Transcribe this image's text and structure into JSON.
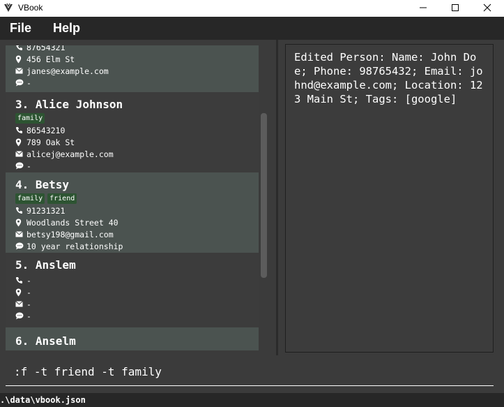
{
  "window": {
    "title": "VBook",
    "minimize_icon": "minimize-icon",
    "maximize_icon": "maximize-icon",
    "close_icon": "close-icon"
  },
  "menu": {
    "file_label": "File",
    "help_label": "Help"
  },
  "persons": [
    {
      "name": "",
      "tags": [],
      "phone": "87654321",
      "address": "456 Elm St",
      "email": "janes@example.com",
      "remark": "-"
    },
    {
      "name": "3. Alice Johnson",
      "tags": [
        "family"
      ],
      "phone": "86543210",
      "address": "789 Oak St",
      "email": "alicej@example.com",
      "remark": "-"
    },
    {
      "name": "4. Betsy",
      "tags": [
        "family",
        "friend"
      ],
      "phone": "91231321",
      "address": "Woodlands Street 40",
      "email": "betsy198@gmail.com",
      "remark": "10 year relationship"
    },
    {
      "name": "5. Anslem",
      "tags": [],
      "phone": "-",
      "address": "-",
      "email": "-",
      "remark": "-"
    },
    {
      "name": "6. Anselm",
      "tags": [],
      "phone": "",
      "address": "",
      "email": "",
      "remark": ""
    }
  ],
  "result": {
    "text": "Edited Person: Name: John Doe; Phone: 98765432; Email: johnd@example.com; Location: 123 Main St; Tags: [google]"
  },
  "command": {
    "value": ":f -t friend -t family"
  },
  "status": {
    "file_path": ".\\data\\vbook.json"
  },
  "colors": {
    "tag_bg": "#2d5432",
    "selected_card_bg": "#4b5350",
    "menubar_bg": "#272727",
    "pane_bg": "#3b3b3b"
  },
  "icons": {
    "phone": "phone-icon",
    "address": "location-pin-icon",
    "email": "envelope-icon",
    "remark": "speech-bubble-icon"
  }
}
